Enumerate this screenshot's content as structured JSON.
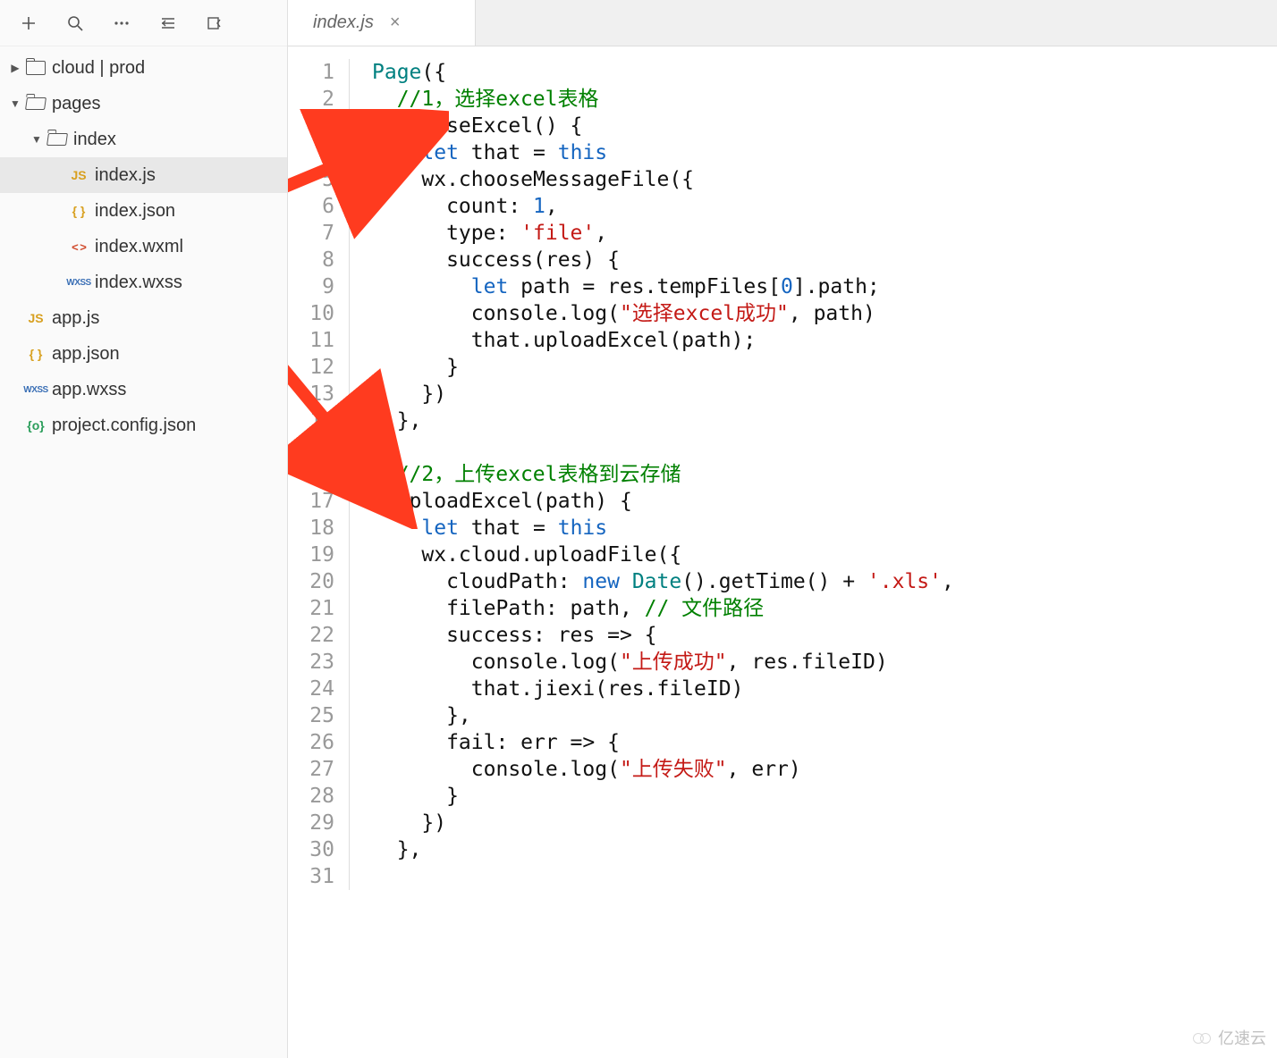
{
  "toolbar": {
    "icons": [
      "plus",
      "search",
      "more",
      "indent",
      "panel"
    ]
  },
  "tree": {
    "root": [
      {
        "label": "cloud | prod",
        "icon": "folder",
        "expanded": false,
        "depth": 0
      },
      {
        "label": "pages",
        "icon": "folder-open",
        "expanded": true,
        "depth": 0
      },
      {
        "label": "index",
        "icon": "folder-open",
        "expanded": true,
        "depth": 1
      },
      {
        "label": "index.js",
        "icon": "js",
        "active": true,
        "depth": 2
      },
      {
        "label": "index.json",
        "icon": "json",
        "depth": 2
      },
      {
        "label": "index.wxml",
        "icon": "wxml",
        "depth": 2
      },
      {
        "label": "index.wxss",
        "icon": "wxss",
        "depth": 2
      },
      {
        "label": "app.js",
        "icon": "js",
        "depth": 0
      },
      {
        "label": "app.json",
        "icon": "json",
        "depth": 0
      },
      {
        "label": "app.wxss",
        "icon": "wxss",
        "depth": 0
      },
      {
        "label": "project.config.json",
        "icon": "cfg",
        "depth": 0
      }
    ]
  },
  "tab": {
    "title": "index.js",
    "close": "×"
  },
  "code": {
    "lines": [
      [
        {
          "t": "Page",
          "c": "fn"
        },
        {
          "t": "({",
          "c": "ident"
        }
      ],
      [
        {
          "t": "  ",
          "c": ""
        },
        {
          "t": "//1，选择excel表格",
          "c": "cm"
        }
      ],
      [
        {
          "t": "  chooseExcel() {",
          "c": "ident"
        }
      ],
      [
        {
          "t": "    ",
          "c": ""
        },
        {
          "t": "let",
          "c": "kw"
        },
        {
          "t": " that = ",
          "c": "ident"
        },
        {
          "t": "this",
          "c": "kw"
        }
      ],
      [
        {
          "t": "    wx.chooseMessageFile({",
          "c": "ident"
        }
      ],
      [
        {
          "t": "      count: ",
          "c": "ident"
        },
        {
          "t": "1",
          "c": "num"
        },
        {
          "t": ",",
          "c": "ident"
        }
      ],
      [
        {
          "t": "      type: ",
          "c": "ident"
        },
        {
          "t": "'file'",
          "c": "str"
        },
        {
          "t": ",",
          "c": "ident"
        }
      ],
      [
        {
          "t": "      success(res) {",
          "c": "ident"
        }
      ],
      [
        {
          "t": "        ",
          "c": ""
        },
        {
          "t": "let",
          "c": "kw"
        },
        {
          "t": " path = res.tempFiles[",
          "c": "ident"
        },
        {
          "t": "0",
          "c": "num"
        },
        {
          "t": "].path;",
          "c": "ident"
        }
      ],
      [
        {
          "t": "        console.log(",
          "c": "ident"
        },
        {
          "t": "\"选择excel成功\"",
          "c": "str"
        },
        {
          "t": ", path)",
          "c": "ident"
        }
      ],
      [
        {
          "t": "        that.uploadExcel(path);",
          "c": "ident"
        }
      ],
      [
        {
          "t": "      }",
          "c": "ident"
        }
      ],
      [
        {
          "t": "    })",
          "c": "ident"
        }
      ],
      [
        {
          "t": "  },",
          "c": "ident"
        }
      ],
      [
        {
          "t": "",
          "c": ""
        }
      ],
      [
        {
          "t": "  ",
          "c": ""
        },
        {
          "t": "//2，上传excel表格到云存储",
          "c": "cm"
        }
      ],
      [
        {
          "t": "  uploadExcel(path) {",
          "c": "ident"
        }
      ],
      [
        {
          "t": "    ",
          "c": ""
        },
        {
          "t": "let",
          "c": "kw"
        },
        {
          "t": " that = ",
          "c": "ident"
        },
        {
          "t": "this",
          "c": "kw"
        }
      ],
      [
        {
          "t": "    wx.cloud.uploadFile({",
          "c": "ident"
        }
      ],
      [
        {
          "t": "      cloudPath: ",
          "c": "ident"
        },
        {
          "t": "new",
          "c": "kw"
        },
        {
          "t": " ",
          "c": ""
        },
        {
          "t": "Date",
          "c": "fn"
        },
        {
          "t": "().getTime() + ",
          "c": "ident"
        },
        {
          "t": "'.xls'",
          "c": "str"
        },
        {
          "t": ",",
          "c": "ident"
        }
      ],
      [
        {
          "t": "      filePath: path, ",
          "c": "ident"
        },
        {
          "t": "// 文件路径",
          "c": "cm"
        }
      ],
      [
        {
          "t": "      success: res => {",
          "c": "ident"
        }
      ],
      [
        {
          "t": "        console.log(",
          "c": "ident"
        },
        {
          "t": "\"上传成功\"",
          "c": "str"
        },
        {
          "t": ", res.fileID)",
          "c": "ident"
        }
      ],
      [
        {
          "t": "        that.jiexi(res.fileID)",
          "c": "ident"
        }
      ],
      [
        {
          "t": "      },",
          "c": "ident"
        }
      ],
      [
        {
          "t": "      fail: err => {",
          "c": "ident"
        }
      ],
      [
        {
          "t": "        console.log(",
          "c": "ident"
        },
        {
          "t": "\"上传失败\"",
          "c": "str"
        },
        {
          "t": ", err)",
          "c": "ident"
        }
      ],
      [
        {
          "t": "      }",
          "c": "ident"
        }
      ],
      [
        {
          "t": "    })",
          "c": "ident"
        }
      ],
      [
        {
          "t": "  },",
          "c": "ident"
        }
      ],
      [
        {
          "t": "",
          "c": ""
        }
      ]
    ]
  },
  "annotation": {
    "color": "#ff3b1f"
  },
  "watermark": "亿速云"
}
